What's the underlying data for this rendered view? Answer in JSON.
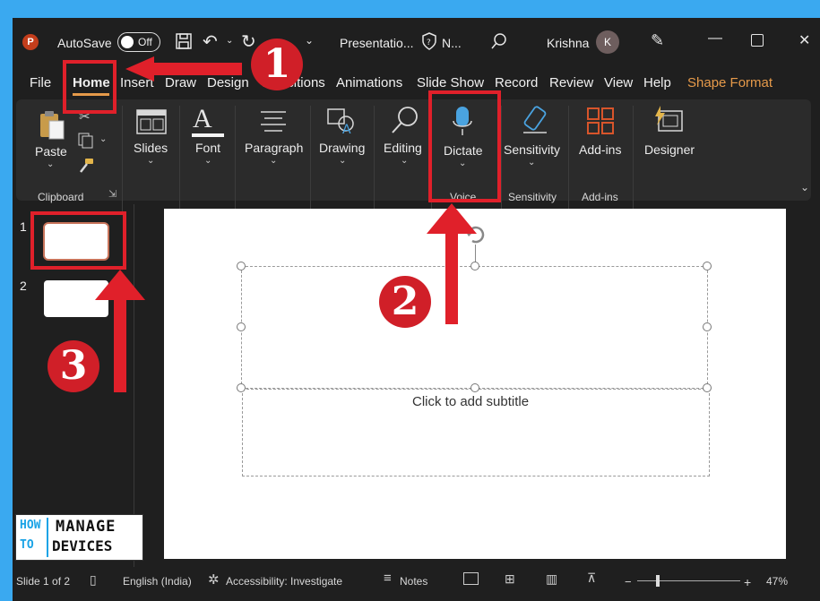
{
  "titlebar": {
    "autosave_label": "AutoSave",
    "autosave_state": "Off",
    "doc_title": "Presentatio...",
    "sensitivity_short": "N...",
    "user_name": "Krishna",
    "user_initial": "K"
  },
  "tabs": [
    "File",
    "Home",
    "Insert",
    "Draw",
    "Design",
    "Transitions",
    "Animations",
    "Slide Show",
    "Record",
    "Review",
    "View",
    "Help",
    "Shape Format"
  ],
  "ribbon": {
    "paste_label": "Paste",
    "clipboard_label": "Clipboard",
    "slides_label": "Slides",
    "font_label": "Font",
    "paragraph_label": "Paragraph",
    "drawing_label": "Drawing",
    "editing_label": "Editing",
    "dictate_label": "Dictate",
    "voice_label": "Voice",
    "sensitivity_label": "Sensitivity",
    "sensitivity_group_label": "Sensitivity",
    "addins_label": "Add-ins",
    "addins_group_label": "Add-ins",
    "designer_label": "Designer"
  },
  "thumbnails": [
    "1",
    "2"
  ],
  "slide": {
    "subtitle_placeholder": "Click to add subtitle"
  },
  "status": {
    "slide_count": "Slide 1 of 2",
    "language": "English (India)",
    "accessibility": "Accessibility: Investigate",
    "notes": "Notes",
    "zoom_minus": "−",
    "zoom_plus": "+",
    "zoom_level": "47%"
  },
  "annotations": {
    "step1": "1",
    "step2": "2",
    "step3": "3"
  },
  "watermark": {
    "how": "HOW",
    "to": "TO",
    "manage": "MANAGE",
    "devices": "DEVICES"
  },
  "colors": {
    "accent_red": "#e0202a",
    "shape_format": "#e69a4a",
    "window_bg": "#1f1f1f",
    "ribbon_bg": "#2b2b2b",
    "frame_bg": "#3aa9f0"
  }
}
